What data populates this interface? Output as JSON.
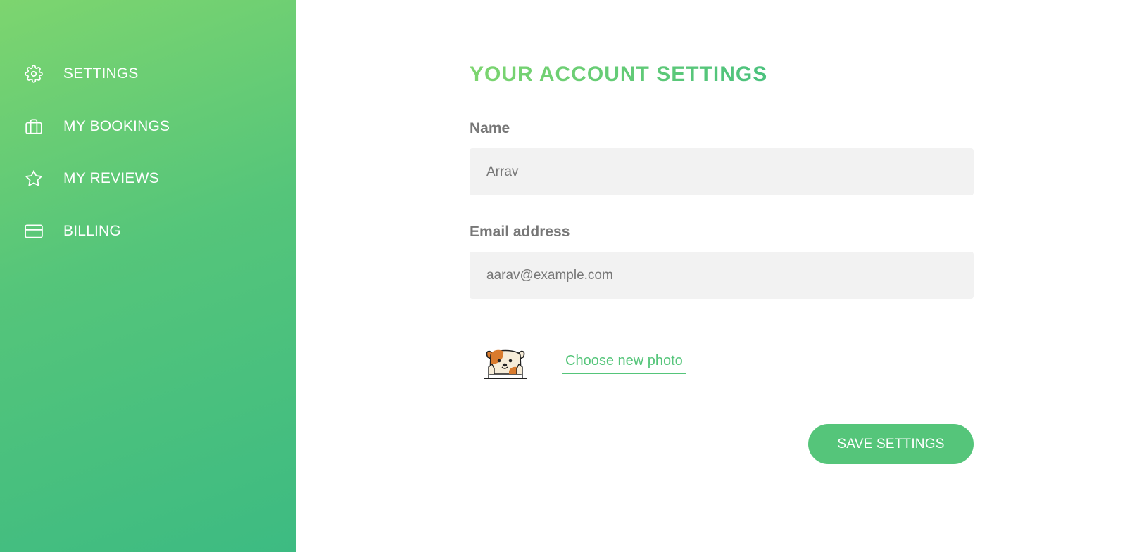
{
  "sidebar": {
    "items": [
      {
        "label": "SETTINGS",
        "icon": "gear-icon"
      },
      {
        "label": "MY BOOKINGS",
        "icon": "briefcase-icon"
      },
      {
        "label": "MY REVIEWS",
        "icon": "star-icon"
      },
      {
        "label": "BILLING",
        "icon": "credit-card-icon"
      }
    ],
    "gradient_colors": [
      "#7dd56f",
      "#28b487"
    ]
  },
  "main": {
    "title": "YOUR ACCOUNT SETTINGS",
    "name_field": {
      "label": "Name",
      "value": "Arrav"
    },
    "email_field": {
      "label": "Email address",
      "value": "aarav@example.com"
    },
    "photo": {
      "link_label": "Choose new photo",
      "avatar_icon": "dog-avatar-icon"
    },
    "save_button": {
      "label": "SAVE SETTINGS"
    }
  },
  "colors": {
    "accent": "#55c57a",
    "input_bg": "#f2f2f2",
    "label": "#777777"
  }
}
